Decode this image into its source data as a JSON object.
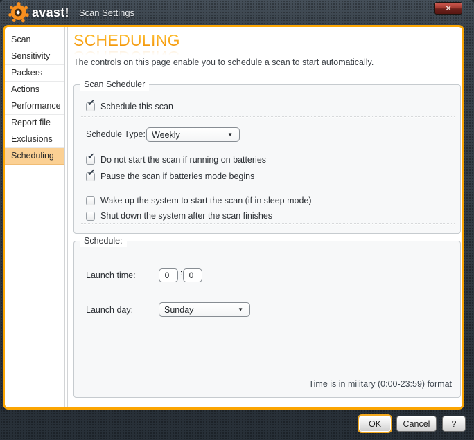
{
  "window": {
    "brand": "avast!",
    "title": "Scan Settings"
  },
  "icons": {
    "close": "✕",
    "checkmark": "✔",
    "chevron_down": "▼"
  },
  "colors": {
    "accent_orange": "#FBA502",
    "titlebar_bg": "#333C45",
    "selected_item_bg": "#FBD093",
    "heading_orange": "#F59B00",
    "close_button_red": "#A23A31",
    "group_fill": "#F7F8F9"
  },
  "sidebar": {
    "items": [
      {
        "label": "Scan",
        "selected": false
      },
      {
        "label": "Sensitivity",
        "selected": false
      },
      {
        "label": "Packers",
        "selected": false
      },
      {
        "label": "Actions",
        "selected": false
      },
      {
        "label": "Performance",
        "selected": false
      },
      {
        "label": "Report file",
        "selected": false
      },
      {
        "label": "Exclusions",
        "selected": false
      },
      {
        "label": "Scheduling",
        "selected": true
      }
    ]
  },
  "main": {
    "heading": "SCHEDULING",
    "description": "The controls on this page enable you to schedule a scan to start automatically.",
    "scan_scheduler": {
      "title": "Scan Scheduler",
      "schedule_this_scan": {
        "label": "Schedule this scan",
        "checked": true
      },
      "schedule_type": {
        "label": "Schedule Type:",
        "value": "Weekly"
      },
      "options": [
        {
          "label": "Do not start the scan if running on batteries",
          "checked": true
        },
        {
          "label": "Pause the scan if batteries mode begins",
          "checked": true
        },
        {
          "label": "Wake up the system to start the scan (if in sleep mode)",
          "checked": false
        },
        {
          "label": "Shut down the system after the scan finishes",
          "checked": false
        }
      ]
    },
    "schedule": {
      "title": "Schedule:",
      "launch_time": {
        "label": "Launch time:",
        "hour": "0",
        "minute": "0",
        "separator": ":"
      },
      "launch_day": {
        "label": "Launch day:",
        "value": "Sunday"
      },
      "note": "Time is in military (0:00-23:59) format"
    }
  },
  "footer": {
    "ok": "OK",
    "cancel": "Cancel",
    "help": "?"
  }
}
